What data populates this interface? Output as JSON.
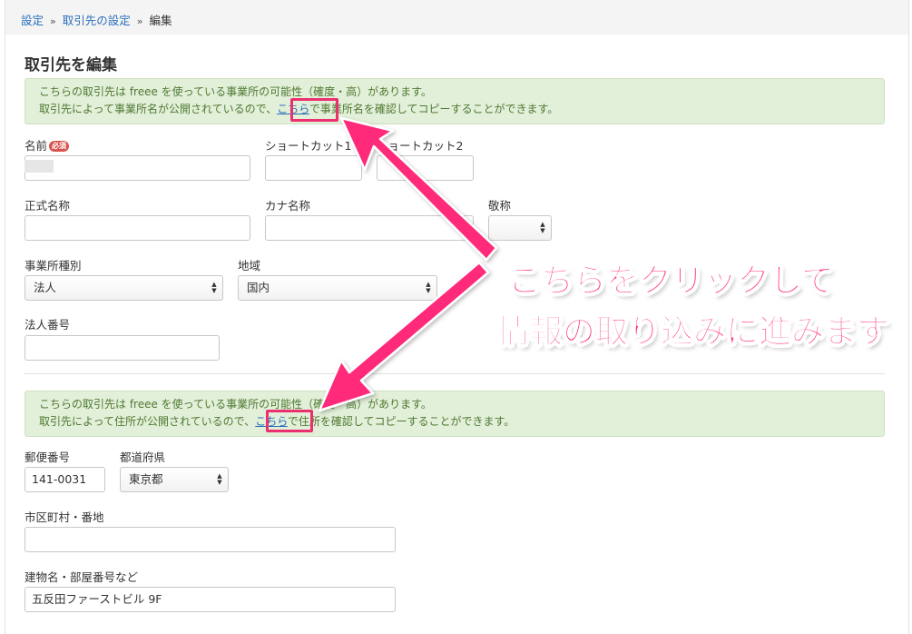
{
  "breadcrumb": {
    "items": [
      "設定",
      "取引先の設定"
    ],
    "separator": "»",
    "current": "編集"
  },
  "page_title": "取引先を編集",
  "alert1": {
    "line1": "こちらの取引先は freee を使っている事業所の可能性（確度・高）があります。",
    "line2_pre": "取引先によって事業所名が公開されているので、",
    "link": "こちら",
    "line2_post": "で事業所名を確認してコピーすることができます。"
  },
  "alert2": {
    "line1": "こちらの取引先は freee を使っている事業所の可能性（確度・高）があります。",
    "line2_pre": "取引先によって住所が公開されているので、",
    "link": "こちら",
    "line2_post": "で住所を確認してコピーすることができます。"
  },
  "fields": {
    "name": {
      "label": "名前",
      "required_badge": "必須",
      "value": ""
    },
    "shortcut1": {
      "label": "ショートカット1",
      "value": ""
    },
    "shortcut2": {
      "label": "ショートカット2",
      "value": ""
    },
    "formal_name": {
      "label": "正式名称",
      "value": ""
    },
    "kana_name": {
      "label": "カナ名称",
      "value": ""
    },
    "honorific": {
      "label": "敬称",
      "value": ""
    },
    "office_type": {
      "label": "事業所種別",
      "value": "法人"
    },
    "region": {
      "label": "地域",
      "value": "国内"
    },
    "corporate_number": {
      "label": "法人番号",
      "value": ""
    },
    "postal_code": {
      "label": "郵便番号",
      "value": "141-0031"
    },
    "prefecture": {
      "label": "都道府県",
      "value": "東京都"
    },
    "city": {
      "label": "市区町村・番地",
      "value": ""
    },
    "building": {
      "label": "建物名・部屋番号など",
      "value": "五反田ファーストビル 9F"
    }
  },
  "select_arrows": {
    "up": "▲",
    "down": "▼"
  },
  "annotation": {
    "line1": "こちらをクリックして",
    "line2": "情報の取り込みに進みます",
    "color": "#ff2b7a"
  }
}
